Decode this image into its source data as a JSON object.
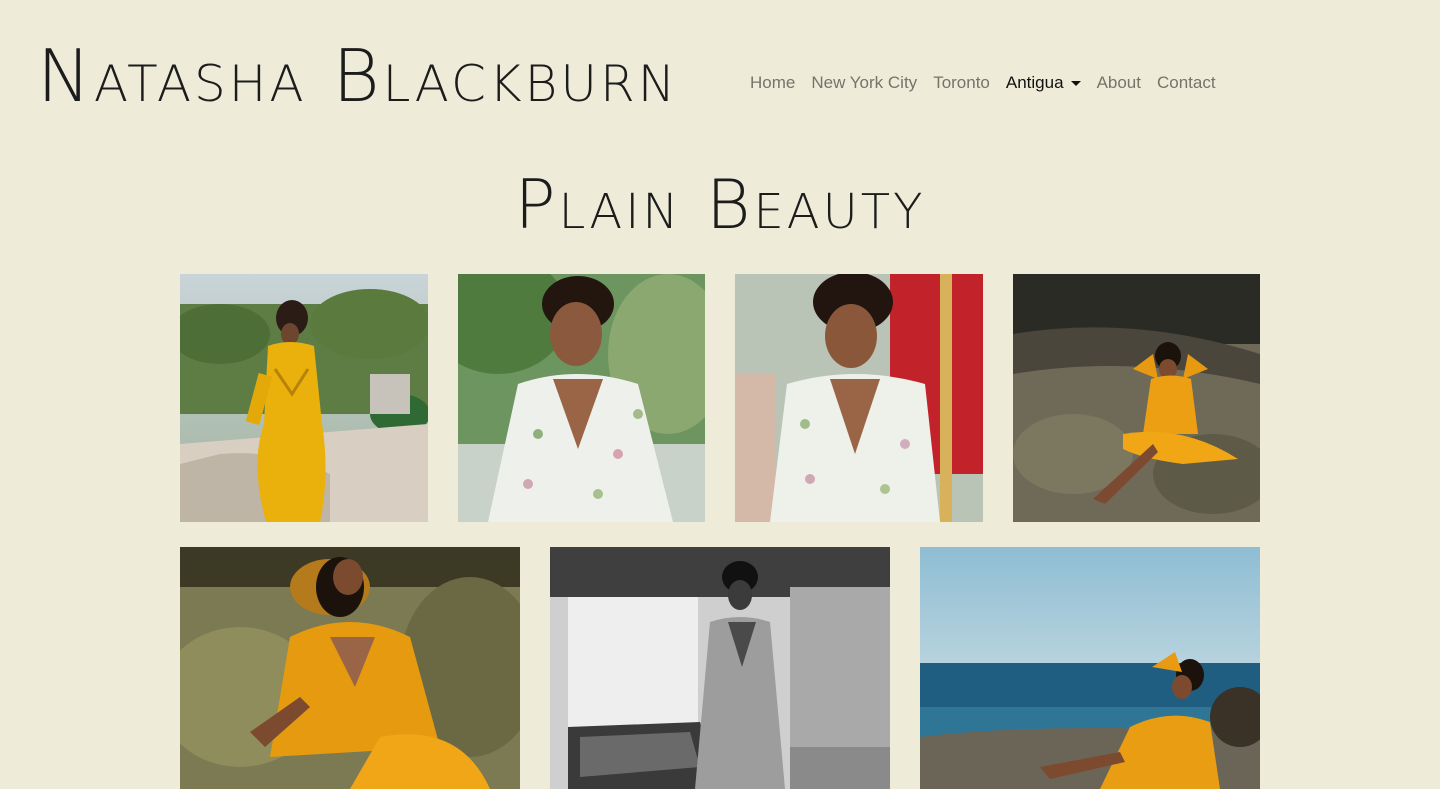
{
  "site": {
    "brand": "Natasha Blackburn"
  },
  "nav": {
    "items": [
      {
        "label": "Home"
      },
      {
        "label": "New York City"
      },
      {
        "label": "Toronto"
      },
      {
        "label": "Antigua",
        "active": true,
        "dropdown": true
      },
      {
        "label": "About"
      },
      {
        "label": "Contact"
      }
    ]
  },
  "page": {
    "title": "Plain Beauty"
  },
  "gallery": {
    "photos": [
      {
        "name": "photo-yellow-dress-palm-beach"
      },
      {
        "name": "photo-floral-dress-greenery"
      },
      {
        "name": "photo-floral-dress-red-boat"
      },
      {
        "name": "photo-orange-dress-rocks"
      },
      {
        "name": "photo-orange-dress-reclining-rocks"
      },
      {
        "name": "photo-black-and-white-building"
      },
      {
        "name": "photo-orange-dress-ocean"
      }
    ]
  },
  "colors": {
    "background": "#eeecd8",
    "text": "#1c1c1c",
    "nav_inactive": "#75736a"
  }
}
